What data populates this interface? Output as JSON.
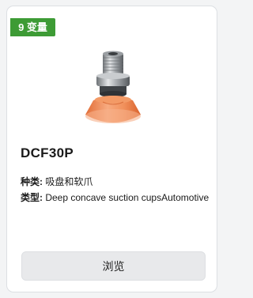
{
  "badge": "9 变量",
  "product": {
    "image_icon": "vacuum-suction-cup-image",
    "title": "DCF30P",
    "spec_type_label": "种类:",
    "spec_type_value": "吸盘和软爪",
    "spec_kind_label": "类型:",
    "spec_kind_value": "Deep concave suction cupsAutomotive"
  },
  "actions": {
    "browse_label": "浏览"
  },
  "colors": {
    "badge": "#3d9b35",
    "cup": "#f08a52",
    "button": "#e8e9eb"
  }
}
